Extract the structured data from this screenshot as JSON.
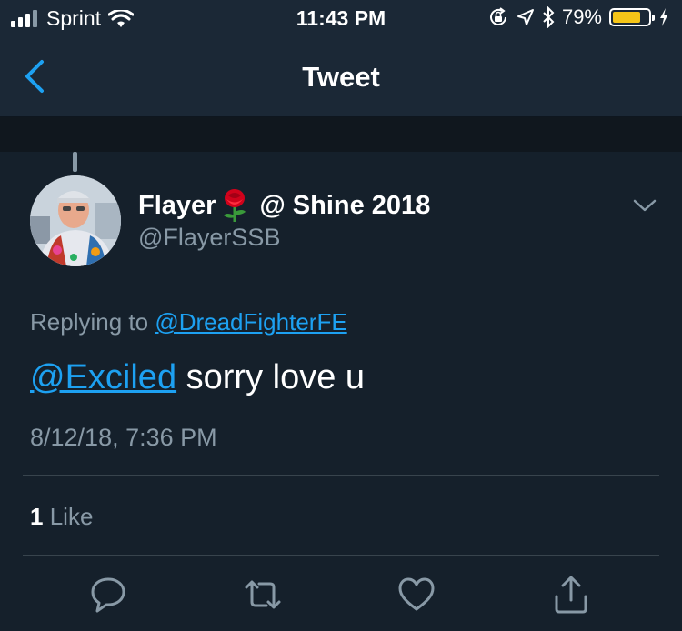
{
  "status_bar": {
    "carrier": "Sprint",
    "time": "11:43 PM",
    "battery_percent": "79%",
    "battery_level": 0.79,
    "battery_color": "#f5c518",
    "icons": [
      "signal-icon",
      "wifi-icon",
      "orientation-lock-icon",
      "location-icon",
      "bluetooth-icon",
      "battery-icon",
      "charging-icon"
    ]
  },
  "nav": {
    "title": "Tweet",
    "back_icon": "chevron-left-icon"
  },
  "tweet": {
    "display_name": "Flayer",
    "display_name_suffix": "@ Shine 2018",
    "handle": "@FlayerSSB",
    "replying_prefix": "Replying to",
    "replying_to": "@DreadFighterFE",
    "mention": "@Exciled",
    "text": "sorry love u",
    "timestamp": "8/12/18, 7:36 PM",
    "like_count": "1",
    "like_label": "Like"
  },
  "actions": [
    "reply-icon",
    "retweet-icon",
    "like-icon",
    "share-icon"
  ],
  "colors": {
    "background": "#15202b",
    "accent": "#1da1f2",
    "secondary_text": "#8899a6"
  }
}
